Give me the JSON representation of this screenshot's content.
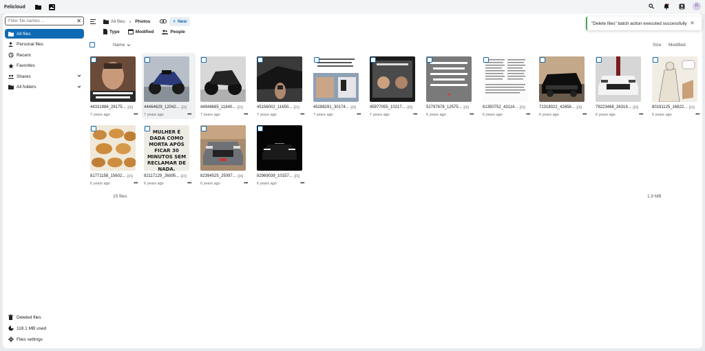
{
  "app": {
    "brand": "Felicloud"
  },
  "topbar_icons": [
    "files-icon",
    "photos-icon"
  ],
  "user": {
    "initial": "R"
  },
  "sidebar": {
    "search": {
      "placeholder": "Filter file names ...",
      "value": ""
    },
    "items": [
      {
        "label": "All files",
        "icon": "folder-icon",
        "active": true,
        "chevron": false
      },
      {
        "label": "Personal files",
        "icon": "person-icon",
        "active": false,
        "chevron": false
      },
      {
        "label": "Recent",
        "icon": "history-icon",
        "active": false,
        "chevron": false
      },
      {
        "label": "Favorites",
        "icon": "star-icon",
        "active": false,
        "chevron": false
      },
      {
        "label": "Shares",
        "icon": "share-icon",
        "active": false,
        "chevron": true
      },
      {
        "label": "All folders",
        "icon": "folder-icon",
        "active": false,
        "chevron": true
      }
    ],
    "bottom": [
      {
        "label": "Deleted files",
        "icon": "trash-icon"
      },
      {
        "label": "118.1 MB used",
        "icon": "storage-icon"
      },
      {
        "label": "Files settings",
        "icon": "gear-icon"
      }
    ]
  },
  "breadcrumb": {
    "root": "All files",
    "current": "Photos",
    "new_label": "New"
  },
  "filters": [
    {
      "label": "Type",
      "icon": "file-icon"
    },
    {
      "label": "Modified",
      "icon": "calendar-icon"
    },
    {
      "label": "People",
      "icon": "people-icon"
    }
  ],
  "columns": {
    "name": "Name",
    "size": "Size",
    "modified": "Modified"
  },
  "files": [
    {
      "base": "44331986_28175...",
      "ext": ".jpg",
      "date": "7 years ago",
      "thumb": "portrait"
    },
    {
      "base": "44464629_12042...",
      "ext": ".jpg",
      "date": "7 years ago",
      "thumb": "moto-blue"
    },
    {
      "base": "44948685_11840...",
      "ext": ".jpg",
      "date": "7 years ago",
      "thumb": "moto-black"
    },
    {
      "base": "45156002_11650...",
      "ext": ".jpg",
      "date": "7 years ago",
      "thumb": "car-dark"
    },
    {
      "base": "45288291_30174...",
      "ext": ".jpg",
      "date": "7 years ago",
      "thumb": "meme-phones"
    },
    {
      "base": "45977055_10217...",
      "ext": ".jpg",
      "date": "7 years ago",
      "thumb": "meme-people"
    },
    {
      "base": "52797678_12575...",
      "ext": ".jpg",
      "date": "5 years ago",
      "thumb": "text-image"
    },
    {
      "base": "61350752_43114...",
      "ext": ".jpg",
      "date": "6 years ago",
      "thumb": "document"
    },
    {
      "base": "71318022_42658...",
      "ext": ".jpg",
      "date": "6 years ago",
      "thumb": "audi-black"
    },
    {
      "base": "79223468_26319...",
      "ext": ".jpg",
      "date": "6 years ago",
      "thumb": "audi-white"
    },
    {
      "base": "80191125_16822...",
      "ext": ".jpg",
      "date": "6 years ago",
      "thumb": "comic"
    },
    {
      "base": "81771158_15602...",
      "ext": ".jpg",
      "date": "6 years ago",
      "thumb": "pastries"
    },
    {
      "base": "82117129_26895...",
      "ext": ".jpg",
      "date": "6 years ago",
      "thumb": "text-meme"
    },
    {
      "base": "82394525_25097...",
      "ext": ".jpg",
      "date": "6 years ago",
      "thumb": "audi-grey"
    },
    {
      "base": "82969039_10157...",
      "ext": ".jpg",
      "date": "6 years ago",
      "thumb": "car-night"
    }
  ],
  "thumb_text": {
    "text_meme": "MULHER É DADA COMO MORTA APÓS FICAR 30 MINUTOS SEM RECLAMAR DE NADA."
  },
  "summary": {
    "count": "15 files",
    "total": "1.9 MB"
  },
  "toast": {
    "message": "\"Delete files\" batch action executed successfully"
  },
  "colors": {
    "accent": "#0f6ab4",
    "success": "#46a35e"
  }
}
